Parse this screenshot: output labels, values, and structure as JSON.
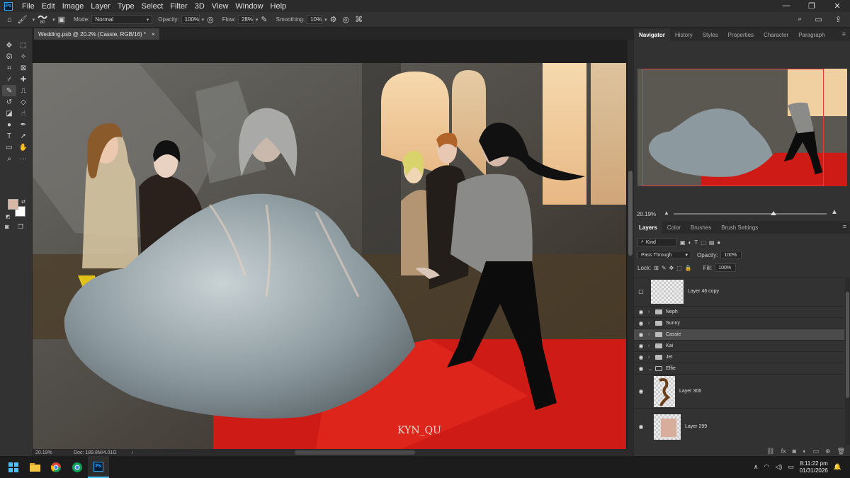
{
  "menubar": {
    "items": [
      "File",
      "Edit",
      "Image",
      "Layer",
      "Type",
      "Select",
      "Filter",
      "3D",
      "View",
      "Window",
      "Help"
    ],
    "logo": "Ps"
  },
  "options": {
    "brush_size": "80",
    "mode_label": "Mode:",
    "mode_value": "Normal",
    "opacity_label": "Opacity:",
    "opacity_value": "100%",
    "flow_label": "Flow:",
    "flow_value": "28%",
    "smoothing_label": "Smoothing:",
    "smoothing_value": "10%"
  },
  "document": {
    "tab_title": "Wedding.psb @ 20.2% (Cassie, RGB/16) *",
    "tab_close": "×",
    "watermark": "KYN_QU",
    "zoom": "20.19%",
    "doc_info": "Doc: 189.8M/4.01G",
    "status_arrow": "›"
  },
  "panels": {
    "top_tabs": [
      "Navigator",
      "History",
      "Styles",
      "Properties",
      "Character",
      "Paragraph"
    ],
    "nav_zoom": "20.19%",
    "layer_tabs": [
      "Layers",
      "Color",
      "Brushes",
      "Brush Settings"
    ],
    "kind_label": "Kind",
    "blend_mode": "Pass Through",
    "opacity_label": "Opacity:",
    "opacity_value": "100%",
    "lock_label": "Lock:",
    "fill_label": "Fill:",
    "fill_value": "100%"
  },
  "layers": [
    {
      "name": "Layer 46 copy",
      "kind": "layer",
      "visible": false
    },
    {
      "name": "Neph",
      "kind": "group",
      "visible": true
    },
    {
      "name": "Sunny",
      "kind": "group",
      "visible": true
    },
    {
      "name": "Cassie",
      "kind": "group",
      "visible": true,
      "selected": true
    },
    {
      "name": "Kai",
      "kind": "group",
      "visible": true
    },
    {
      "name": "Jet",
      "kind": "group",
      "visible": true
    },
    {
      "name": "Effie",
      "kind": "group-open",
      "visible": true
    },
    {
      "name": "Layer 306",
      "kind": "layer",
      "visible": true
    },
    {
      "name": "Layer 299",
      "kind": "layer",
      "visible": true
    }
  ],
  "taskbar": {
    "time": "8:11:22 pm",
    "date": "01/31/2026",
    "ps_label": "Ps"
  },
  "colors": {
    "foreground": "#d7b8a4",
    "background": "#ffffff",
    "accent": "#31a8ff"
  }
}
